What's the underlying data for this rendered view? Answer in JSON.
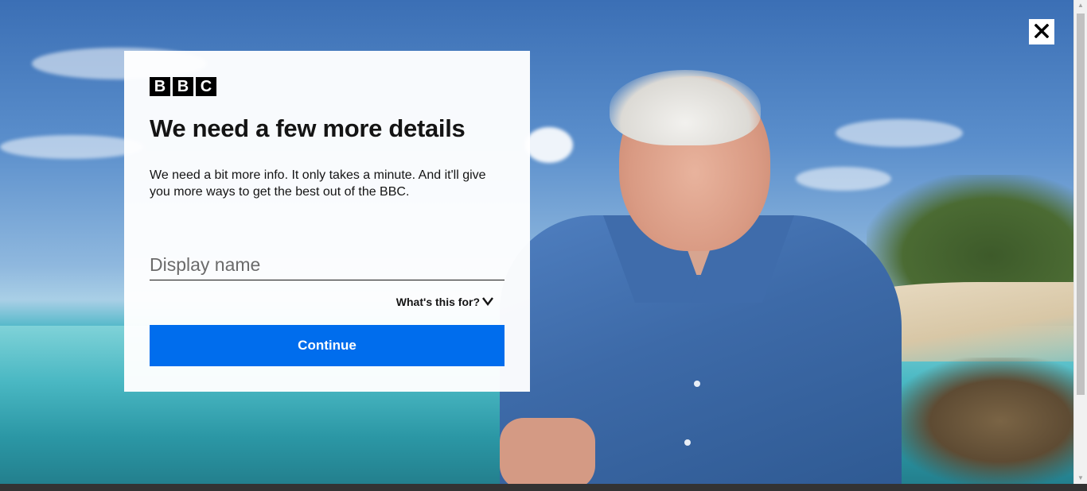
{
  "modal": {
    "logo_letters": [
      "B",
      "B",
      "C"
    ],
    "title": "We need a few more details",
    "description": "We need a bit more info. It only takes a minute. And it'll give you more ways to get the best out of the BBC.",
    "display_name_placeholder": "Display name",
    "display_name_value": "",
    "help_link": "What's this for?",
    "continue_label": "Continue"
  },
  "close_icon": "close-icon",
  "colors": {
    "primary_button": "#006ded",
    "card_bg": "#ffffff",
    "text": "#141414"
  }
}
